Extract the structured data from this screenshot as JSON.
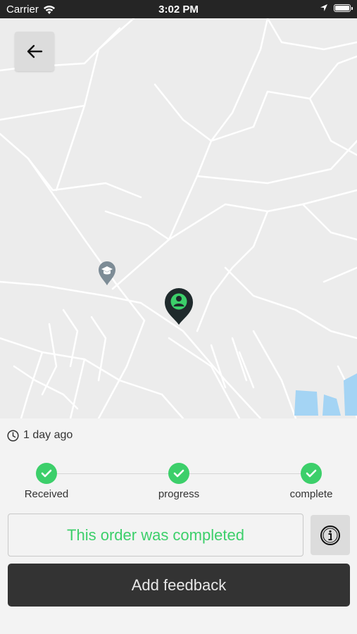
{
  "status_bar": {
    "carrier": "Carrier",
    "time": "3:02 PM"
  },
  "map": {
    "background_color": "#ececec",
    "road_color": "#ffffff",
    "water_color": "#a4d4f4",
    "pins": [
      {
        "name": "education-pin",
        "icon": "graduation-cap-icon",
        "color": "#7d8c96"
      },
      {
        "name": "user-location-pin",
        "icon": "person-icon",
        "color": "#1f2a2c",
        "accent": "#3ccf6a"
      }
    ]
  },
  "order": {
    "time_ago": "1 day ago",
    "steps": [
      {
        "label": "Received",
        "done": true
      },
      {
        "label": "progress",
        "done": true
      },
      {
        "label": "complete",
        "done": true
      }
    ],
    "status_message": "This order was completed",
    "feedback_label": "Add feedback"
  },
  "colors": {
    "accent": "#3ccf6a",
    "button_dark": "#333333"
  }
}
